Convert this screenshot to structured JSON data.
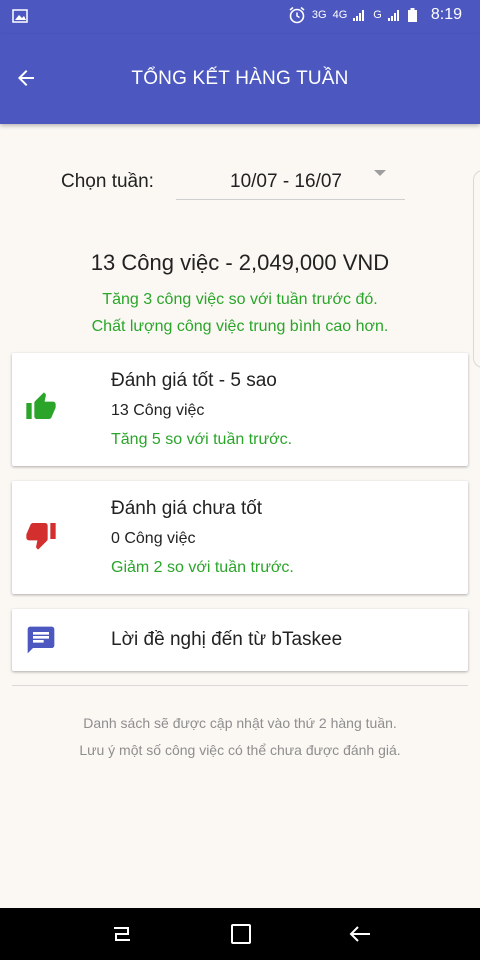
{
  "status_bar": {
    "network_1": "3G",
    "network_2": "4G",
    "network_3": "G",
    "time": "8:19"
  },
  "app_bar": {
    "title": "TỔNG KẾT HÀNG TUẦN",
    "back_icon": "arrow-left-icon",
    "color": "#4c58c0"
  },
  "week_picker": {
    "label": "Chọn tuần:",
    "value": "10/07 - 16/07"
  },
  "summary": {
    "total": "13 Công việc - 2,049,000 VND",
    "increase_note": "Tăng 3 công việc so với tuần trước đó.",
    "quality_note": "Chất lượng công việc trung bình cao hơn."
  },
  "cards": {
    "good": {
      "icon": "thumbs-up-icon",
      "title": "Đánh giá tốt - 5 sao",
      "count": "13 Công việc",
      "trend": "Tăng 5 so với tuần trước.",
      "icon_color": "#2aa52a"
    },
    "bad": {
      "icon": "thumbs-down-icon",
      "title": "Đánh giá chưa tốt",
      "count": "0 Công việc",
      "trend": "Giảm 2 so với tuần trước.",
      "icon_color": "#d32f2f"
    },
    "suggest": {
      "icon": "chat-message-icon",
      "title": "Lời đề nghị đến từ bTaskee",
      "icon_color": "#4c58c0"
    }
  },
  "footer_notes": {
    "line1": "Danh sách sẽ được cập nhật vào thứ 2 hàng tuần.",
    "line2": "Lưu ý một số công việc có thể chưa được đánh giá."
  },
  "colors": {
    "positive": "#2aa52a",
    "background": "#fbf8f4"
  }
}
